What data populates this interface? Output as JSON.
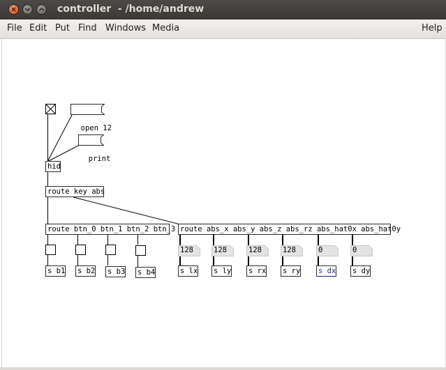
{
  "window": {
    "title": "controller  - /home/andrew"
  },
  "menu": {
    "file": "File",
    "edit": "Edit",
    "put": "Put",
    "find": "Find",
    "windows": "Windows",
    "media": "Media",
    "help": "Help"
  },
  "patch": {
    "toggle_state": "on",
    "open_msg": "open 12",
    "print_msg": "print",
    "hid_obj": "hid",
    "route_key_abs": "route key abs",
    "route_btn": "route btn_0 btn_1 btn_2 btn_3",
    "route_abs": "route abs_x abs_y abs_z abs_rz abs_hat0x abs_hat0y",
    "sends": {
      "b1": "s b1",
      "b2": "s b2",
      "b3": "s b3",
      "b4": "s b4",
      "lx": "s lx",
      "ly": "s ly",
      "rx": "s rx",
      "ry": "s ry",
      "dx": "s dx",
      "dy": "s dy"
    },
    "numbers": {
      "n1": "128",
      "n2": "128",
      "n3": "128",
      "n4": "128",
      "n5": "0",
      "n6": "0"
    }
  }
}
